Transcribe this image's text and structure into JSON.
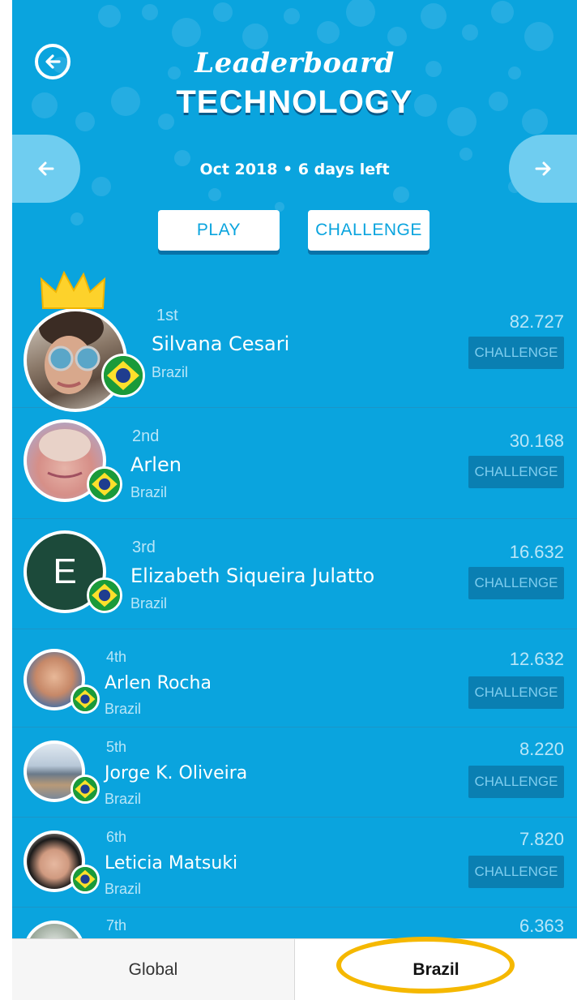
{
  "header": {
    "title_script": "Leaderboard",
    "title_main": "TECHNOLOGY",
    "period": "Oct 2018 • 6 days left",
    "play_label": "PLAY",
    "challenge_label": "CHALLENGE"
  },
  "rows": [
    {
      "rank": "1st",
      "name": "Silvana Cesari",
      "country": "Brazil",
      "score": "82.727",
      "challenge": "CHALLENGE"
    },
    {
      "rank": "2nd",
      "name": "Arlen",
      "country": "Brazil",
      "score": "30.168",
      "challenge": "CHALLENGE"
    },
    {
      "rank": "3rd",
      "name": "Elizabeth Siqueira Julatto",
      "country": "Brazil",
      "score": "16.632",
      "challenge": "CHALLENGE",
      "initial": "E"
    },
    {
      "rank": "4th",
      "name": "Arlen Rocha",
      "country": "Brazil",
      "score": "12.632",
      "challenge": "CHALLENGE"
    },
    {
      "rank": "5th",
      "name": "Jorge K. Oliveira",
      "country": "Brazil",
      "score": "8.220",
      "challenge": "CHALLENGE"
    },
    {
      "rank": "6th",
      "name": "Leticia Matsuki",
      "country": "Brazil",
      "score": "7.820",
      "challenge": "CHALLENGE"
    },
    {
      "rank": "7th",
      "score": "6.363"
    }
  ],
  "tabs": {
    "global": "Global",
    "brazil": "Brazil",
    "active": "Brazil"
  },
  "colors": {
    "background": "#0aa4de",
    "highlight": "#f5b800",
    "challenge_bg": "#0a7fb2"
  },
  "icons": {
    "back": "back-arrow-circle-icon",
    "prev": "arrow-left-icon",
    "next": "arrow-right-icon",
    "crown": "crown-icon",
    "flag": "brazil-flag-icon"
  }
}
